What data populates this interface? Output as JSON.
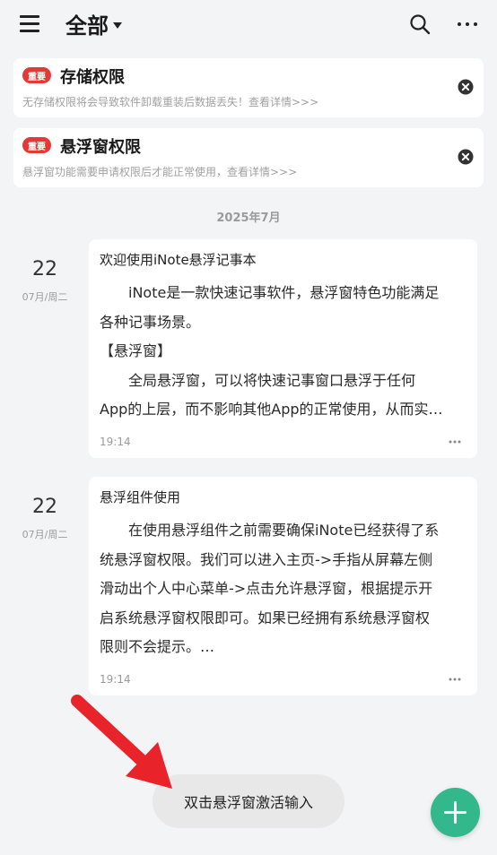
{
  "header": {
    "title": "全部"
  },
  "notices": [
    {
      "badge": "重要",
      "title": "存储权限",
      "subtitle": "无存储权限将会导致软件卸载重装后数据丢失！查看详情>>>"
    },
    {
      "badge": "重要",
      "title": "悬浮窗权限",
      "subtitle": "悬浮窗功能需要申请权限后才能正常使用，查看详情>>>"
    }
  ],
  "month_label": "2025年7月",
  "notes": [
    {
      "day": "22",
      "weekday": "07月/周二",
      "title": "欢迎使用iNote悬浮记事本",
      "lines": [
        "　　iNote是一款快速记事软件，悬浮窗特色功能满足",
        "各种记事场景。",
        "【悬浮窗】",
        "　　全局悬浮窗，可以将快速记事窗口悬浮于任何",
        "App的上层，而不影响其他App的正常使用，从而实…"
      ],
      "time": "19:14"
    },
    {
      "day": "22",
      "weekday": "07月/周二",
      "title": "悬浮组件使用",
      "lines": [
        "　　在使用悬浮组件之前需要确保iNote已经获得了系",
        "统悬浮窗权限。我们可以进入主页->手指从屏幕左侧",
        "滑动出个人中心菜单->点击允许悬浮窗，根据提示开",
        "启系统悬浮窗权限即可。如果已经拥有系统悬浮窗权",
        "限则不会提示。…"
      ],
      "time": "19:14"
    }
  ],
  "toast": "双击悬浮窗激活输入",
  "colors": {
    "background": "#f3f4f6",
    "badge": "#e53935",
    "fab": "#33b88c",
    "arrow": "#e8232a"
  },
  "icons": {
    "menu": "menu-icon",
    "dropdown": "caret-down-icon",
    "search": "search-icon",
    "more": "more-icon",
    "close": "close-icon",
    "add": "plus-icon"
  }
}
